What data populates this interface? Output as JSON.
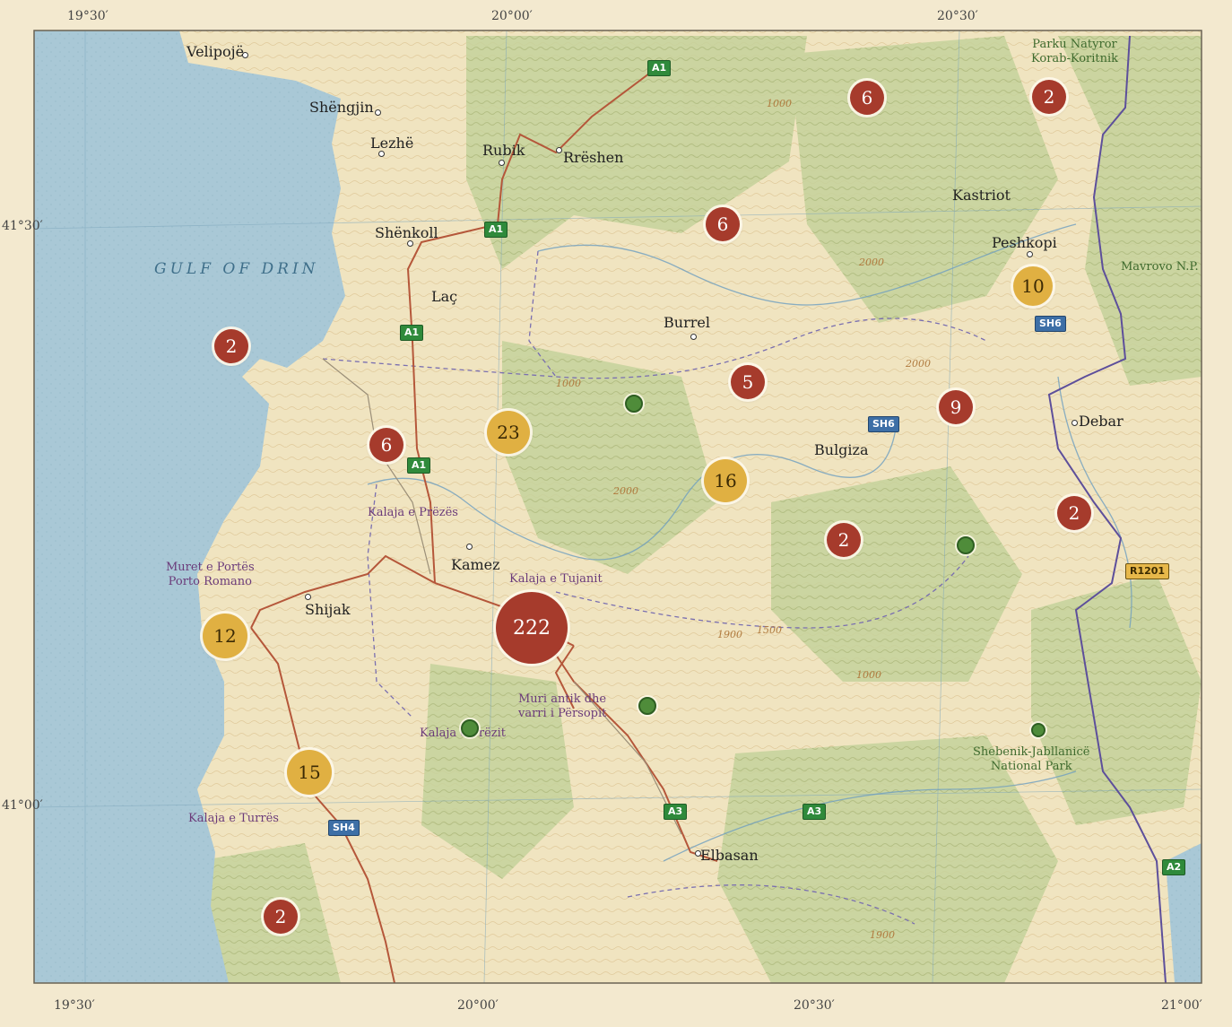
{
  "graticule": {
    "top": [
      "19°30′",
      "20°00′",
      "20°30′"
    ],
    "left": [
      "41°30′",
      "41°00′"
    ],
    "bottom": [
      "19°30′",
      "20°00′",
      "20°30′",
      "21°00′"
    ]
  },
  "water": {
    "gulf_label": "GULF OF DRIN"
  },
  "cities": [
    {
      "name": "Velipojë"
    },
    {
      "name": "Shëngjin"
    },
    {
      "name": "Lezhë"
    },
    {
      "name": "Rubik"
    },
    {
      "name": "Rrëshen"
    },
    {
      "name": "Shënkoll"
    },
    {
      "name": "Laç"
    },
    {
      "name": "Burrel"
    },
    {
      "name": "Kastriot"
    },
    {
      "name": "Peshkopi"
    },
    {
      "name": "Debar"
    },
    {
      "name": "Bulgiza"
    },
    {
      "name": "Kamez"
    },
    {
      "name": "Shijak"
    },
    {
      "name": "Elbasan"
    }
  ],
  "pois": [
    {
      "name": "Kalaja e Prëzës"
    },
    {
      "name": "Muret e Portës\nPorto Romano"
    },
    {
      "name": "Kalaja e Tujanit"
    },
    {
      "name": "Muri antik dhe\nvarri i Përsopit"
    },
    {
      "name": "Kalaja e Prëzit"
    },
    {
      "name": "Kalaja e Turrës"
    }
  ],
  "parks": [
    {
      "name": "Parku Natyror\nKorab-Koritnik"
    },
    {
      "name": "Mavrovo N.P."
    },
    {
      "name": "Shebenik-Jabllanicë\nNational Park"
    }
  ],
  "road_shields": [
    {
      "label": "A1",
      "style": "green"
    },
    {
      "label": "A1",
      "style": "green"
    },
    {
      "label": "A1",
      "style": "green"
    },
    {
      "label": "A1",
      "style": "green"
    },
    {
      "label": "SH6",
      "style": "blue"
    },
    {
      "label": "SH6",
      "style": "blue"
    },
    {
      "label": "R1201",
      "style": "yellow"
    },
    {
      "label": "A3",
      "style": "green"
    },
    {
      "label": "A3",
      "style": "green"
    },
    {
      "label": "SH4",
      "style": "blue"
    },
    {
      "label": "A2",
      "style": "green"
    }
  ],
  "clusters": [
    {
      "count": "6",
      "kind": "red"
    },
    {
      "count": "2",
      "kind": "red"
    },
    {
      "count": "6",
      "kind": "red"
    },
    {
      "count": "10",
      "kind": "gold"
    },
    {
      "count": "2",
      "kind": "red"
    },
    {
      "count": "5",
      "kind": "red"
    },
    {
      "count": "9",
      "kind": "red"
    },
    {
      "count": "6",
      "kind": "red"
    },
    {
      "count": "23",
      "kind": "gold"
    },
    {
      "count": "16",
      "kind": "gold"
    },
    {
      "count": "2",
      "kind": "red"
    },
    {
      "count": "2",
      "kind": "red"
    },
    {
      "count": "12",
      "kind": "gold"
    },
    {
      "count": "222",
      "kind": "red"
    },
    {
      "count": "15",
      "kind": "gold"
    },
    {
      "count": "2",
      "kind": "red"
    }
  ],
  "contour_labels": [
    "1000",
    "2000",
    "2000",
    "1000",
    "2000",
    "1900",
    "1500",
    "1000",
    "1900"
  ],
  "colors": {
    "cluster_red": "#a63b2c",
    "cluster_gold": "#e0b042",
    "water": "#a9c8d6",
    "land": "#efe3bf",
    "forest": "#b9c98f",
    "road": "#b5573a",
    "border": "#6a5a9e"
  }
}
